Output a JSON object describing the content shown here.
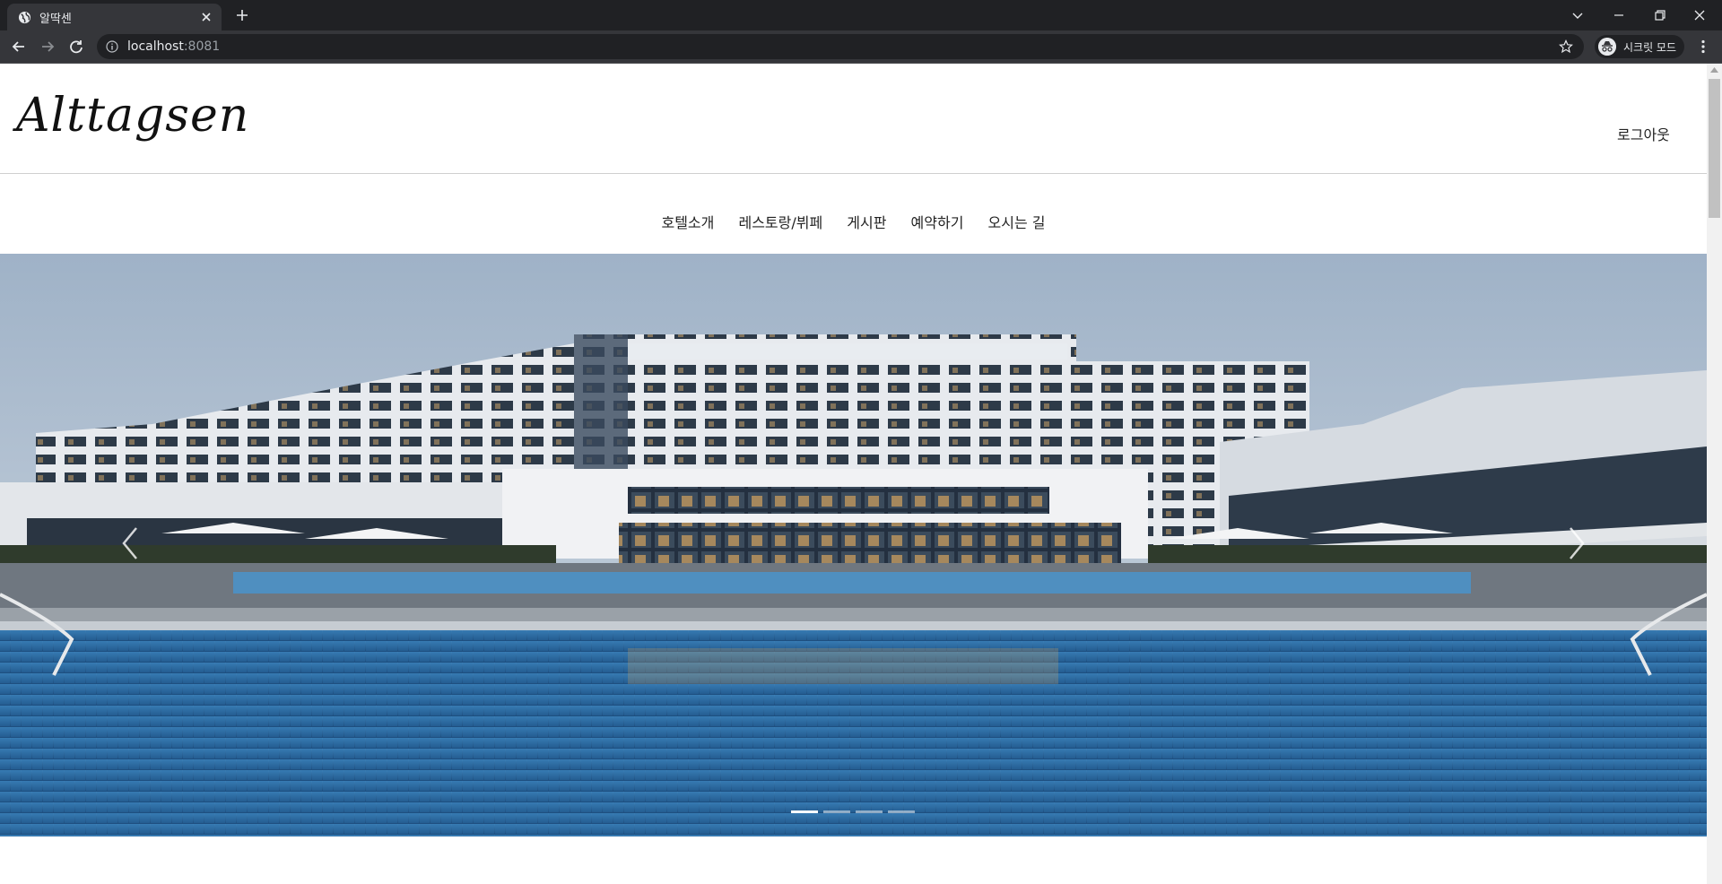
{
  "browser": {
    "tab_title": "알딱센",
    "url_host": "localhost",
    "url_port": ":8081",
    "incognito_label": "시크릿 모드",
    "icons": [
      "globe-icon",
      "close-icon",
      "plus-icon",
      "chevron-down-icon",
      "minimize-icon",
      "restore-icon",
      "window-close-icon",
      "back-icon",
      "forward-icon",
      "reload-icon",
      "info-icon",
      "star-icon",
      "incognito-icon",
      "kebab-menu-icon"
    ]
  },
  "header": {
    "logo_text": "Alttagsen",
    "logout_label": "로그아웃"
  },
  "nav": {
    "items": [
      {
        "label": "호텔소개"
      },
      {
        "label": "레스토랑/뷔페"
      },
      {
        "label": "게시판"
      },
      {
        "label": "예약하기"
      },
      {
        "label": "오시는 길"
      }
    ]
  },
  "carousel": {
    "slide_count": 4,
    "active_index": 0,
    "image": "hotel-pool-photo",
    "colors": {
      "sky": "#b9c6d4",
      "building": "#dfe3e8",
      "pool": "#2c6fa8"
    }
  }
}
